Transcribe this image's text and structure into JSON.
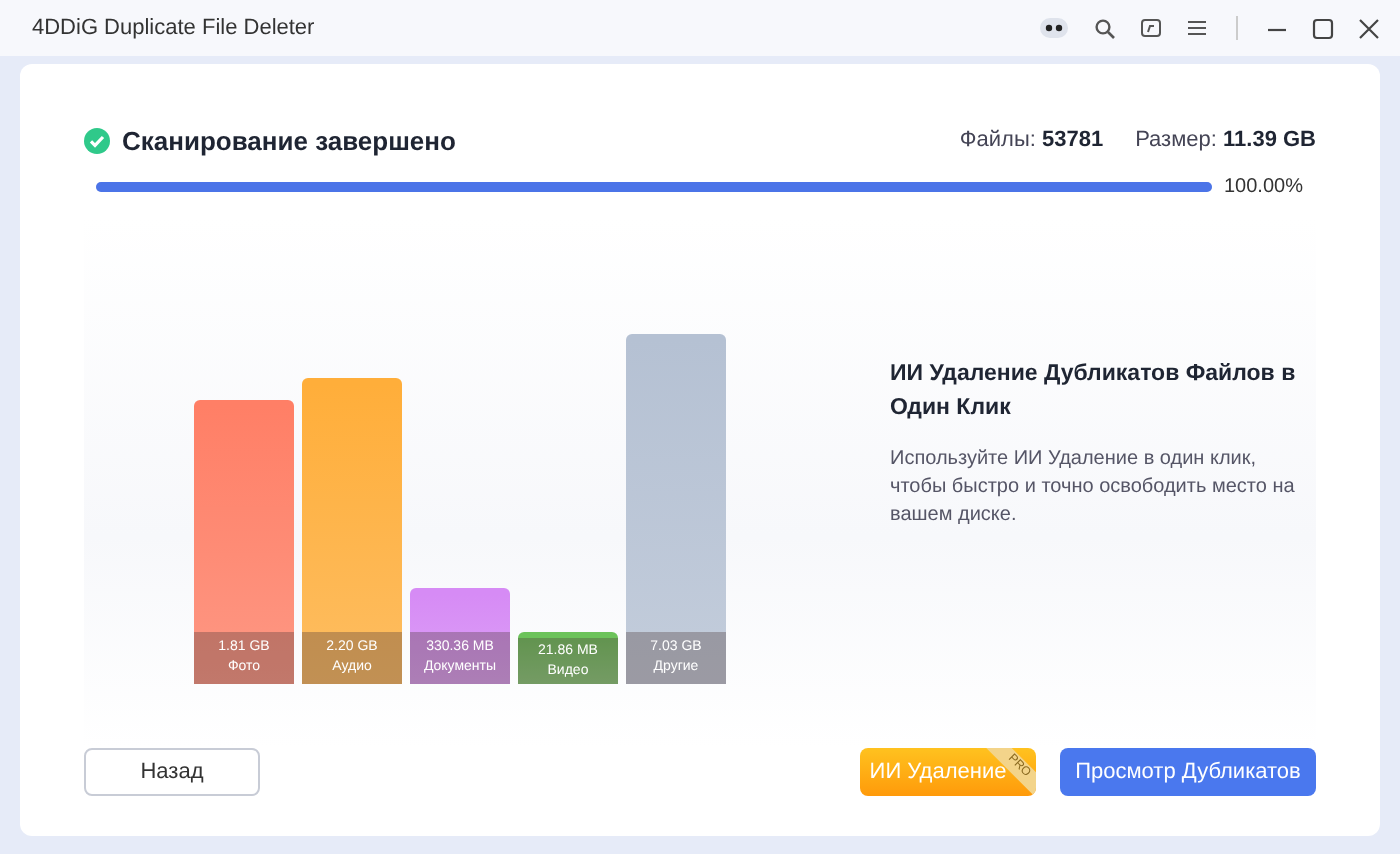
{
  "window": {
    "title": "4DDiG Duplicate File Deleter"
  },
  "scan": {
    "status": "Сканирование завершено",
    "files_label": "Файлы:",
    "files_value": "53781",
    "size_label": "Размер:",
    "size_value": "11.39 GB",
    "level": 1,
    "percent": "100.00%"
  },
  "categories": [
    {
      "size": "1.81 GB",
      "name": "Фото",
      "color": "#ff7f66"
    },
    {
      "size": "2.20 GB",
      "name": "Аудио",
      "color": "#ffae3a"
    },
    {
      "size": "330.36 MB",
      "name": "Документы",
      "color": "#d68bf5"
    },
    {
      "size": "21.86 MB",
      "name": "Видео",
      "color": "#6cc35a"
    },
    {
      "size": "7.03 GB",
      "name": "Другие",
      "color": "#b5c1d3"
    }
  ],
  "promo": {
    "title": "ИИ Удаление Дубликатов Файлов в Один Клик",
    "text": "Используйте ИИ Удаление в один клик, чтобы быстро и точно освободить место на вашем диске."
  },
  "buttons": {
    "back": "Назад",
    "ai": "ИИ Удаление",
    "ai_badge": "PRO",
    "view": "Просмотр Дубликатов"
  }
}
